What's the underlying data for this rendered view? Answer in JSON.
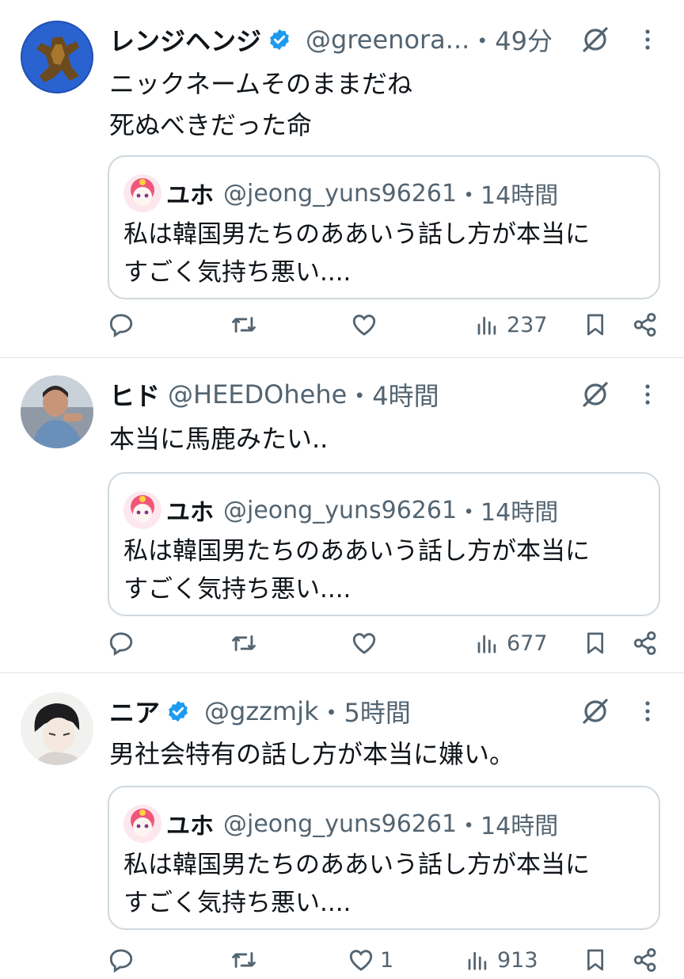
{
  "tweets": [
    {
      "name": "レンジヘンジ",
      "verified": true,
      "handle": "@greenora...",
      "time": "・49分",
      "text_lines": [
        "ニックネームそのままだね",
        "死ぬべきだった命"
      ],
      "quote": {
        "name": "ユホ",
        "handle": "@jeong_yuns96261",
        "time": "・14時間",
        "lines": [
          "私は韓国男たちのああいう話し方が本当に",
          "すごく気持ち悪い...."
        ]
      },
      "likes": "",
      "views": "237"
    },
    {
      "name": "ヒド",
      "verified": false,
      "handle": "@HEEDOhehe",
      "time": "・4時間",
      "text_lines": [
        "本当に馬鹿みたい.."
      ],
      "quote": {
        "name": "ユホ",
        "handle": "@jeong_yuns96261",
        "time": "・14時間",
        "lines": [
          "私は韓国男たちのああいう話し方が本当に",
          "すごく気持ち悪い...."
        ]
      },
      "likes": "",
      "views": "677"
    },
    {
      "name": "ニア",
      "verified": true,
      "handle": "@gzzmjk",
      "time": "・5時間",
      "text_lines": [
        "男社会特有の話し方が本当に嫌い。"
      ],
      "quote": {
        "name": "ユホ",
        "handle": "@jeong_yuns96261",
        "time": "・14時間",
        "lines": [
          "私は韓国男たちのああいう話し方が本当に",
          "すごく気持ち悪い...."
        ]
      },
      "likes": "1",
      "views": "913"
    }
  ],
  "icons": {
    "reply": "reply-icon",
    "retweet": "retweet-icon",
    "like": "heart-icon",
    "views": "views-icon",
    "bookmark": "bookmark-icon",
    "share": "share-icon",
    "grok": "grok-icon",
    "more": "more-icon",
    "verified": "verified-badge-icon"
  },
  "colors": {
    "verified": "#1d9bf0",
    "secondary_text": "#536471",
    "border": "#cfd9de"
  }
}
